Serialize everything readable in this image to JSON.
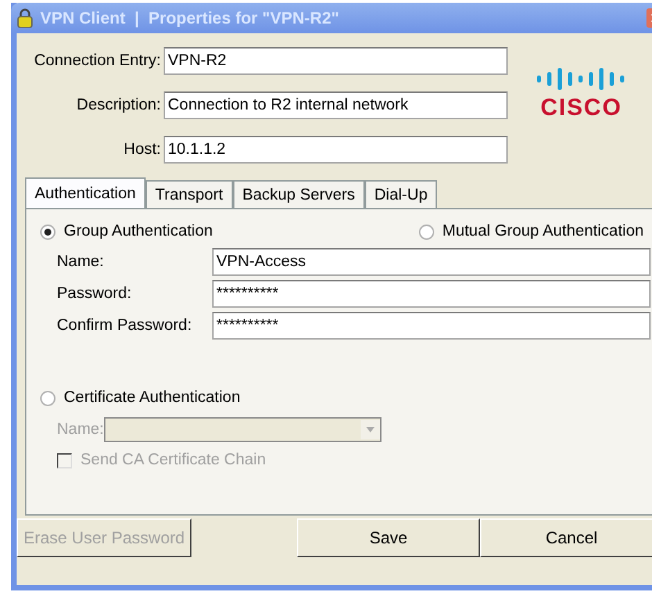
{
  "window": {
    "title": "VPN Client  |  Properties for \"VPN-R2\""
  },
  "fields": [
    {
      "label": "Connection Entry:",
      "value": "VPN-R2"
    },
    {
      "label": "Description:",
      "value": "Connection to R2 internal network"
    },
    {
      "label": "Host:",
      "value": "10.1.1.2"
    }
  ],
  "logo": {
    "text": "CISCO"
  },
  "tabs": [
    {
      "label": "Authentication",
      "selected": true
    },
    {
      "label": "Transport",
      "selected": false
    },
    {
      "label": "Backup Servers",
      "selected": false
    },
    {
      "label": "Dial-Up",
      "selected": false
    }
  ],
  "group_authentication": {
    "label": "Group Authentication",
    "selected": true,
    "fields": [
      {
        "label": "Name:",
        "value": "VPN-Access"
      },
      {
        "label": "Password:",
        "value": "**********"
      },
      {
        "label": "Confirm Password:",
        "value": "**********"
      }
    ]
  },
  "mutual_group_authentication": {
    "label": "Mutual Group Authentication",
    "selected": false
  },
  "certificate_authentication": {
    "label": "Certificate Authentication",
    "selected": false,
    "name": {
      "label": "Name:",
      "disabled": true
    },
    "send_chain": {
      "label": "Send CA Certificate Chain",
      "checked": false,
      "disabled": true
    }
  },
  "buttons": [
    {
      "label": "Erase User Password",
      "disabled": true
    },
    {
      "label": "Save",
      "disabled": false
    },
    {
      "label": "Cancel",
      "disabled": false
    }
  ]
}
